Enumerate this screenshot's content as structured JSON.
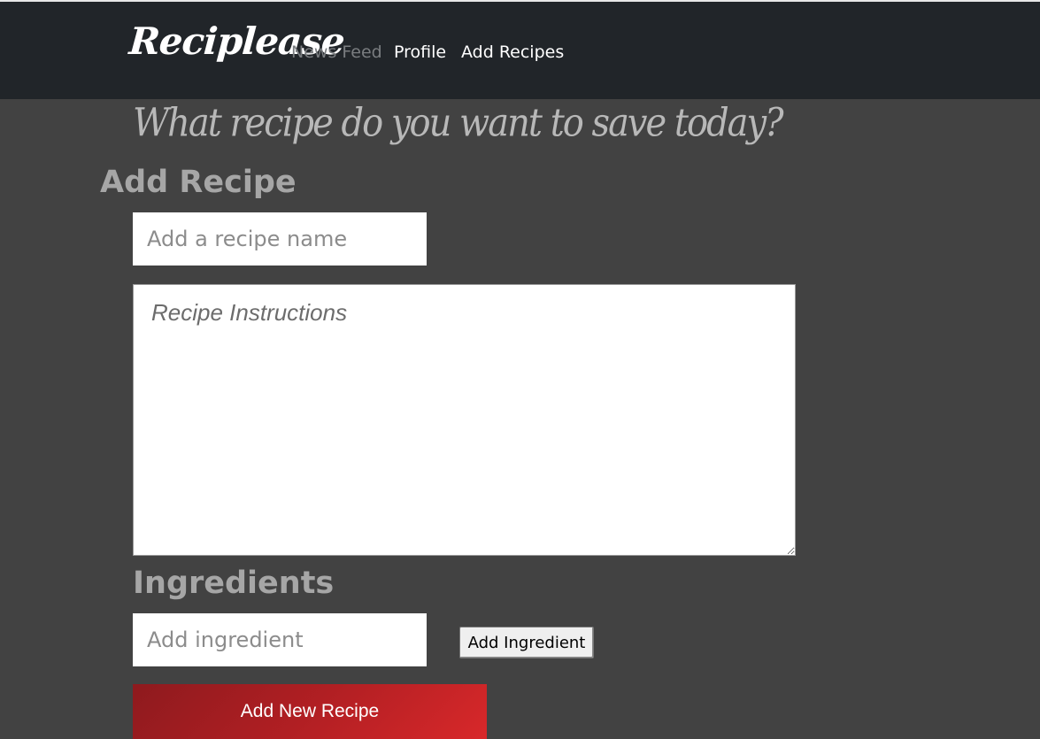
{
  "navbar": {
    "brand": "Reciplease",
    "links": [
      {
        "label": "News Feed",
        "state": "muted"
      },
      {
        "label": "Profile",
        "state": "active"
      },
      {
        "label": "Add Recipes",
        "state": "active"
      }
    ]
  },
  "tagline": "What recipe do you want to save today?",
  "form": {
    "title": "Add Recipe",
    "recipe_name_placeholder": "Add a recipe name",
    "instructions_placeholder": "Recipe Instructions",
    "ingredients_title": "Ingredients",
    "ingredient_placeholder": "Add ingredient",
    "add_ingredient_label": "Add Ingredient",
    "submit_label": "Add New Recipe"
  },
  "colors": {
    "navbar_bg": "#212529",
    "page_bg": "#424242",
    "submit_button": "#b11f23"
  }
}
